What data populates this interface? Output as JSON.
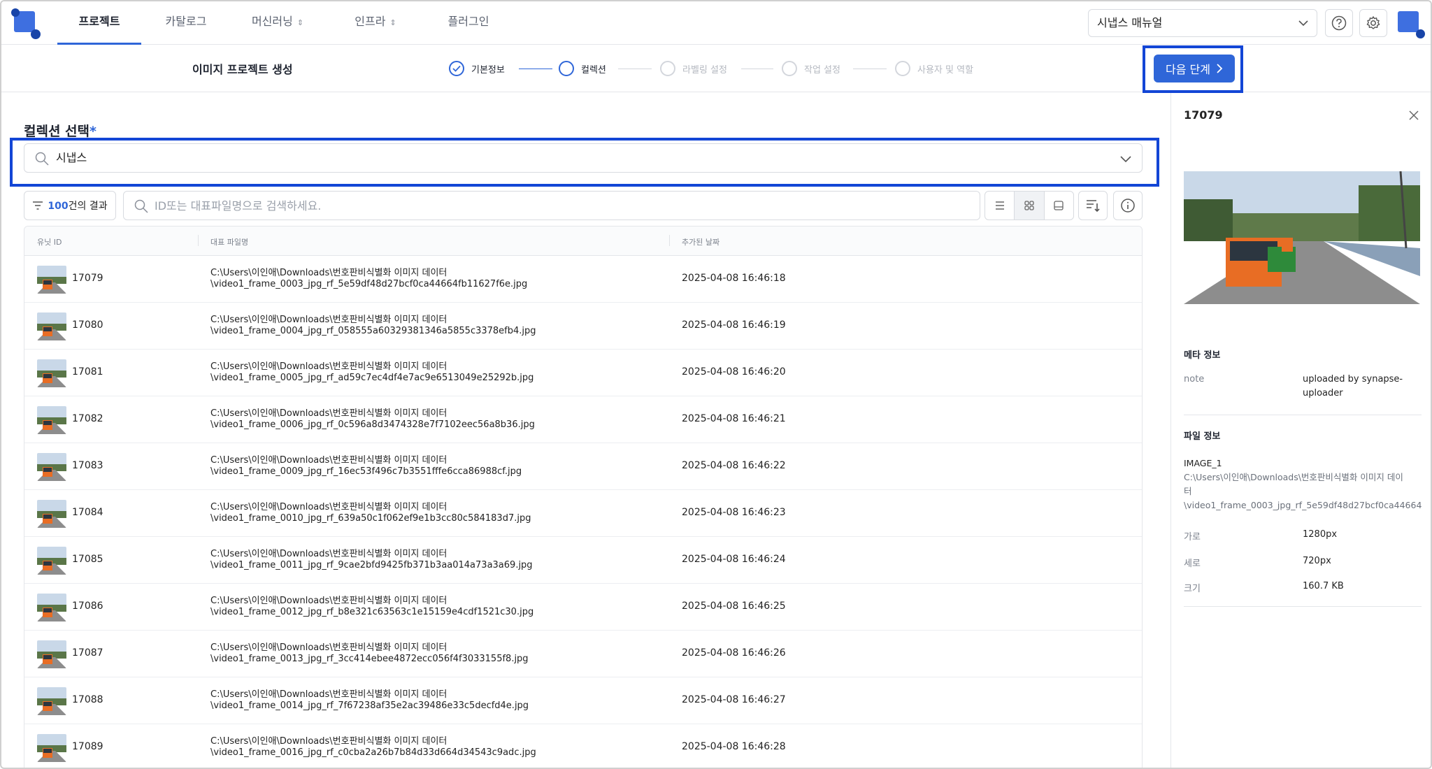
{
  "nav": {
    "tabs": [
      {
        "label": "프로젝트"
      },
      {
        "label": "카탈로그"
      },
      {
        "label": "머신러닝"
      },
      {
        "label": "인프라"
      },
      {
        "label": "플러그인"
      }
    ],
    "manual_label": "시냅스 매뉴얼",
    "icons": [
      "chevron-down-icon",
      "help-icon",
      "gear-icon",
      "avatar"
    ]
  },
  "subheader": {
    "title": "이미지 프로젝트 생성",
    "steps": [
      {
        "label": "기본정보",
        "state": "done"
      },
      {
        "label": "컬렉션",
        "state": "current"
      },
      {
        "label": "라벨링 설정",
        "state": "todo"
      },
      {
        "label": "작업 설정",
        "state": "todo"
      },
      {
        "label": "사용자 및 역할",
        "state": "todo"
      }
    ],
    "next_label": "다음 단계",
    "accent": "#2f66d8",
    "highlight": "#1346d6"
  },
  "collection": {
    "label": "컬렉션 선택",
    "required_mark": "*",
    "value": "시냅스"
  },
  "toolbar": {
    "count": "100",
    "count_suffix": "건의 결과",
    "search_placeholder": "ID또는 대표파일명으로 검색하세요."
  },
  "table": {
    "columns": [
      "유닛 ID",
      "대표 파일명",
      "추가된 날짜"
    ],
    "rows": [
      {
        "id": "17079",
        "path1": "C:\\Users\\이인애\\Downloads\\번호판비식별화 이미지 데이터",
        "path2": "\\video1_frame_0003_jpg_rf_5e59df48d27bcf0ca44664fb11627f6e.jpg",
        "date": "2025-04-08 16:46:18"
      },
      {
        "id": "17080",
        "path1": "C:\\Users\\이인애\\Downloads\\번호판비식별화 이미지 데이터",
        "path2": "\\video1_frame_0004_jpg_rf_058555a60329381346a5855c3378efb4.jpg",
        "date": "2025-04-08 16:46:19"
      },
      {
        "id": "17081",
        "path1": "C:\\Users\\이인애\\Downloads\\번호판비식별화 이미지 데이터",
        "path2": "\\video1_frame_0005_jpg_rf_ad59c7ec4df4e7ac9e6513049e25292b.jpg",
        "date": "2025-04-08 16:46:20"
      },
      {
        "id": "17082",
        "path1": "C:\\Users\\이인애\\Downloads\\번호판비식별화 이미지 데이터",
        "path2": "\\video1_frame_0006_jpg_rf_0c596a8d3474328e7f7102eec56a8b36.jpg",
        "date": "2025-04-08 16:46:21"
      },
      {
        "id": "17083",
        "path1": "C:\\Users\\이인애\\Downloads\\번호판비식별화 이미지 데이터",
        "path2": "\\video1_frame_0009_jpg_rf_16ec53f496c7b3551fffe6cca86988cf.jpg",
        "date": "2025-04-08 16:46:22"
      },
      {
        "id": "17084",
        "path1": "C:\\Users\\이인애\\Downloads\\번호판비식별화 이미지 데이터",
        "path2": "\\video1_frame_0010_jpg_rf_639a50c1f062ef9e1b3cc80c584183d7.jpg",
        "date": "2025-04-08 16:46:23"
      },
      {
        "id": "17085",
        "path1": "C:\\Users\\이인애\\Downloads\\번호판비식별화 이미지 데이터",
        "path2": "\\video1_frame_0011_jpg_rf_9cae2bfd9425fb371b3aa014a73a3a69.jpg",
        "date": "2025-04-08 16:46:24"
      },
      {
        "id": "17086",
        "path1": "C:\\Users\\이인애\\Downloads\\번호판비식별화 이미지 데이터",
        "path2": "\\video1_frame_0012_jpg_rf_b8e321c63563c1e15159e4cdf1521c30.jpg",
        "date": "2025-04-08 16:46:25"
      },
      {
        "id": "17087",
        "path1": "C:\\Users\\이인애\\Downloads\\번호판비식별화 이미지 데이터",
        "path2": "\\video1_frame_0013_jpg_rf_3cc414ebee4872ecc056f4f3033155f8.jpg",
        "date": "2025-04-08 16:46:26"
      },
      {
        "id": "17088",
        "path1": "C:\\Users\\이인애\\Downloads\\번호판비식별화 이미지 데이터",
        "path2": "\\video1_frame_0014_jpg_rf_7f67238af35e2ac39486e33c5decfd4e.jpg",
        "date": "2025-04-08 16:46:27"
      },
      {
        "id": "17089",
        "path1": "C:\\Users\\이인애\\Downloads\\번호판비식별화 이미지 데이터",
        "path2": "\\video1_frame_0016_jpg_rf_c0cba2a26b7b84d33d664d34543c9adc.jpg",
        "date": "2025-04-08 16:46:28"
      }
    ]
  },
  "detail": {
    "title": "17079",
    "meta_heading": "메타 정보",
    "meta_key": "note",
    "meta_value": "uploaded by synapse-uploader",
    "file_heading": "파일 정보",
    "file_name": "IMAGE_1",
    "file_path1": "C:\\Users\\이인애\\Downloads\\번호판비식별화 이미지 데이",
    "file_path2": "터",
    "file_path3": "\\video1_frame_0003_jpg_rf_5e59df48d27bcf0ca44664",
    "props": [
      {
        "key": "가로",
        "value": "1280px"
      },
      {
        "key": "세로",
        "value": "720px"
      },
      {
        "key": "크기",
        "value": "160.7 KB"
      }
    ]
  }
}
